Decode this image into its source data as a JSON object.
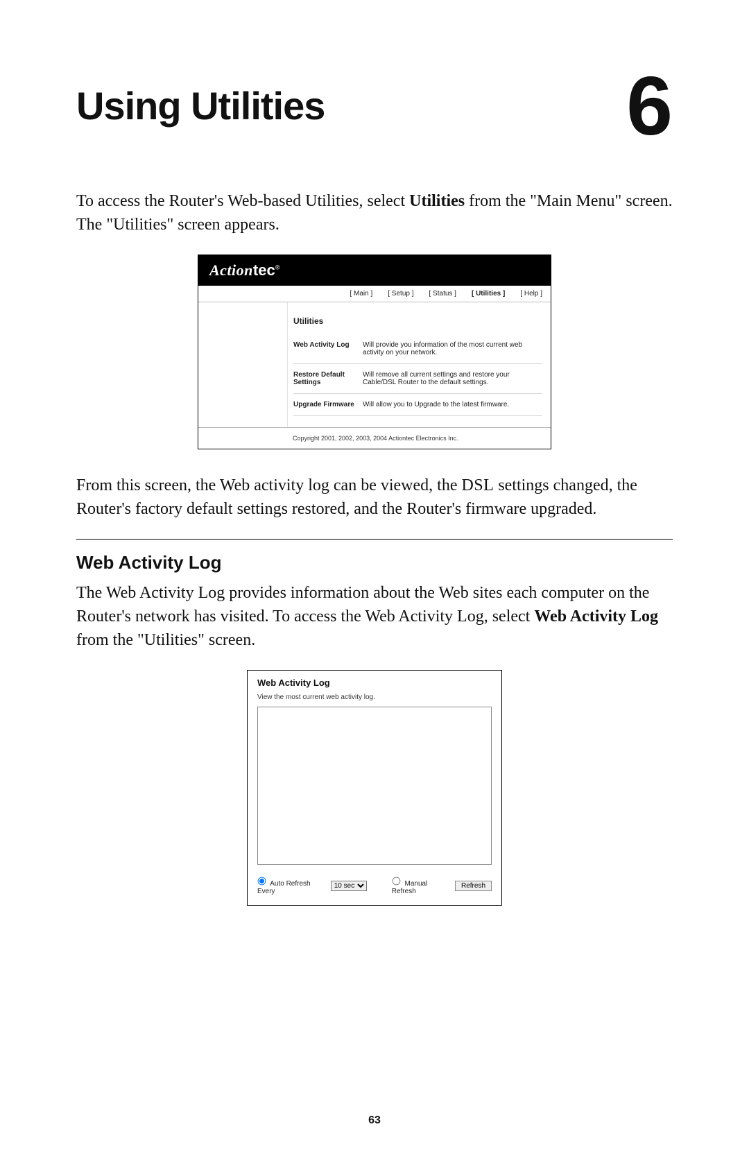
{
  "chapter": {
    "title": "Using Utilities",
    "number": "6"
  },
  "intro_parts": {
    "p1a": "To access the Router's Web-based Utilities, select ",
    "p1b_bold": "Utilities",
    "p1c": " from the \"Main Menu\" screen. The \"Utilities\" screen appears."
  },
  "shot1": {
    "logo_script": "Action",
    "logo_sans": "tec",
    "reg": "®",
    "tabs": {
      "main": "[ Main ]",
      "setup": "[ Setup ]",
      "status": "[ Status ]",
      "utilities": "[ Utilities ]",
      "help": "[ Help ]"
    },
    "heading": "Utilities",
    "rows": [
      {
        "k": "Web Activity Log",
        "v": "Will provide you information of the most current web activity on your network."
      },
      {
        "k": "Restore Default Settings",
        "v": "Will remove all current settings and restore your Cable/DSL Router to the default settings."
      },
      {
        "k": "Upgrade Firmware",
        "v": "Will allow you to Upgrade to the latest firmware."
      }
    ],
    "footer": "Copyright 2001, 2002, 2003, 2004 Actiontec Electronics Inc."
  },
  "mid_paragraph": {
    "a": "From this screen, the Web activity log can be viewed, the ",
    "dsl": "DSL",
    "b": " settings changed, the Router's factory default settings restored, and the Router's firmware upgraded."
  },
  "section": {
    "h": "Web Activity Log",
    "p_a": "The Web Activity Log provides information about the Web sites each computer on the Router's network has visited. To access the Web Activity Log, select ",
    "p_bold": "Web Activity Log",
    "p_b": " from the \"Utilities\" screen."
  },
  "shot2": {
    "h": "Web Activity Log",
    "sub": "View the most current web activity log.",
    "auto_label": "Auto Refresh Every",
    "select_value": "10 sec",
    "manual_label": "Manual Refresh",
    "refresh_btn": "Refresh"
  },
  "page_number": "63"
}
